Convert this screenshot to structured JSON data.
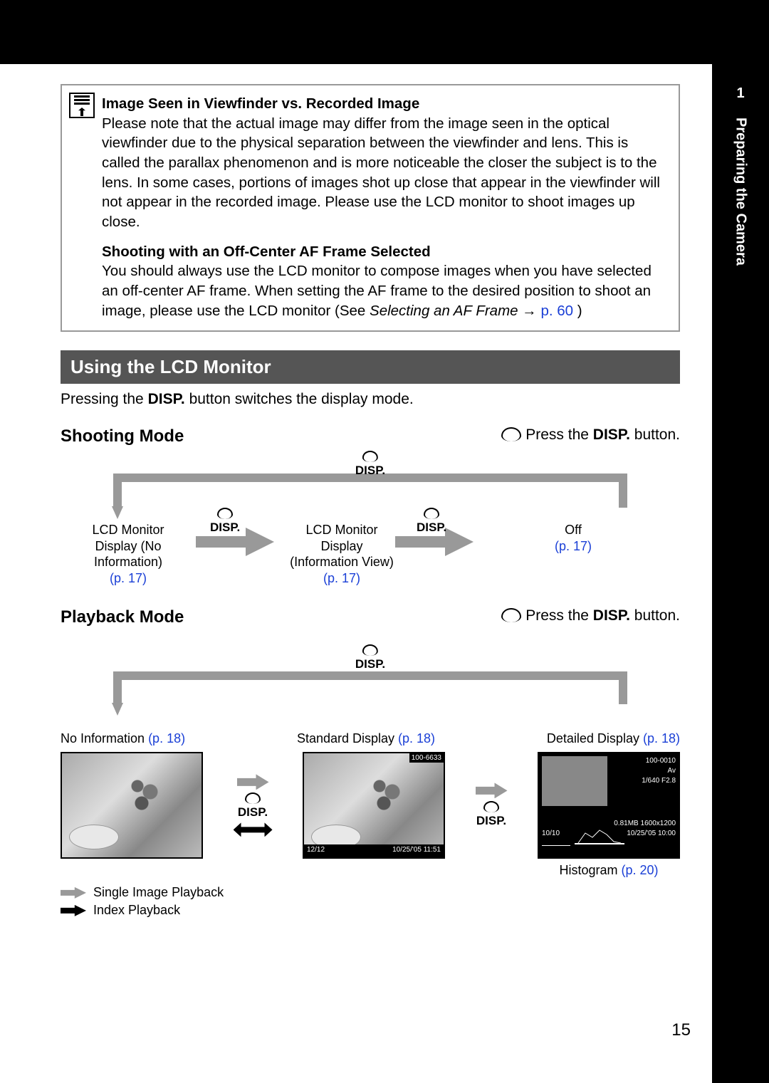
{
  "sidebar": {
    "chapter": "1",
    "title": "Preparing the Camera"
  },
  "infobox": {
    "h1": "Image Seen in Viewfinder vs. Recorded Image",
    "p1": "Please note that the actual image may differ from the image seen in the optical viewfinder due to the physical separation between the viewfinder and lens. This is called the parallax phenomenon and is more noticeable the closer the subject is to the lens. In some cases, portions of images shot up close that appear in the viewfinder will not appear in the recorded image. Please use the LCD monitor to shoot images up close.",
    "h2": "Shooting with an Off-Center AF Frame Selected",
    "p2a": "You should always use the LCD monitor to compose images when you have selected an off-center AF frame. When setting the AF frame to the desired position to shoot an image, please use the LCD monitor (See ",
    "p2_italic": "Selecting an AF Frame",
    "p2_arrow": " → ",
    "p2_link": "p. 60",
    "p2_end": ")"
  },
  "section": {
    "title": "Using the LCD Monitor",
    "body_a": "Pressing the ",
    "body_bold": "DISP.",
    "body_b": " button switches the display mode."
  },
  "shooting": {
    "title": "Shooting Mode",
    "instr_a": "Press the ",
    "instr_bold": "DISP.",
    "instr_b": " button.",
    "disp": "DISP.",
    "node1a": "LCD Monitor",
    "node1b": "Display (No",
    "node1c": "Information)",
    "node1_link": "(p. 17)",
    "node2a": "LCD Monitor",
    "node2b": "Display",
    "node2c": "(Information View)",
    "node2_link": "(p. 17)",
    "node3a": "Off",
    "node3_link": "(p. 17)"
  },
  "playback": {
    "title": "Playback Mode",
    "instr_a": "Press the ",
    "instr_bold": "DISP.",
    "instr_b": " button.",
    "disp": "DISP.",
    "col1": "No Information ",
    "col1_link": "(p. 18)",
    "col2": "Standard Display ",
    "col2_link": "(p. 18)",
    "col3": "Detailed Display ",
    "col3_link": "(p. 18)",
    "strip2a": "100-6633",
    "strip2b": "12/12",
    "strip2c": "10/25/'05  11:51",
    "det_topright": "100-0010",
    "det_l1": "Av",
    "det_l2": "1/640    F2.8",
    "det_l3": "0.81MB 1600x1200",
    "det_l4": "10/10",
    "det_l5": "10/25/'05 10:00",
    "histogram": "Histogram ",
    "histogram_link": "(p. 20)",
    "legend1": "Single Image Playback",
    "legend2": "Index Playback"
  },
  "page_number": "15"
}
